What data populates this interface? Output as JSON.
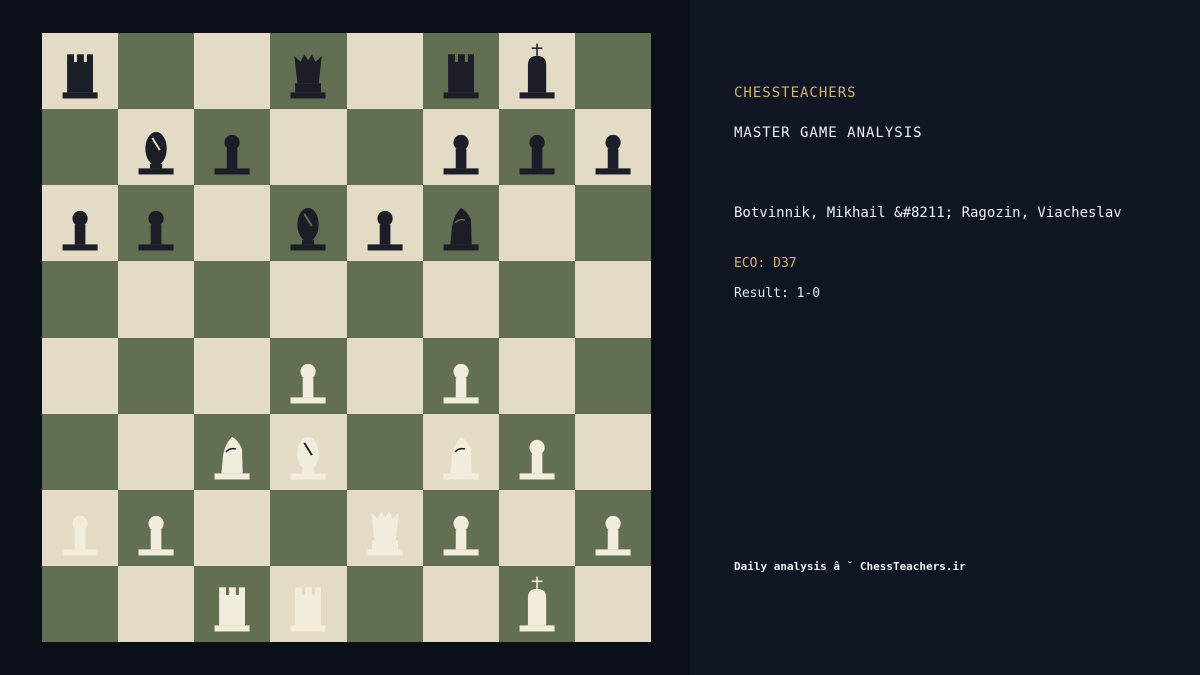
{
  "colors": {
    "light_square": "#e3dbc5",
    "dark_square": "#636f52",
    "black_piece": "#1b1e27",
    "white_piece": "#f1ecdc",
    "accent": "#d4b26a",
    "text": "#eef0f4",
    "page_bg": "#0b0f18",
    "panel_bg": "#101624"
  },
  "board": {
    "ranks": [
      [
        "r",
        "",
        "",
        "q",
        "",
        "r",
        "k",
        ""
      ],
      [
        "",
        "b",
        "p",
        "",
        "",
        "p",
        "p",
        "p"
      ],
      [
        "p",
        "p",
        "",
        "b",
        "p",
        "n",
        "",
        ""
      ],
      [
        "",
        "",
        "",
        "",
        "",
        "",
        "",
        ""
      ],
      [
        "",
        "",
        "",
        "P",
        "",
        "P",
        "",
        ""
      ],
      [
        "",
        "",
        "N",
        "B",
        "",
        "N",
        "P",
        ""
      ],
      [
        "P",
        "P",
        "",
        "",
        "Q",
        "P",
        "",
        "P"
      ],
      [
        "",
        "",
        "R",
        "R",
        "",
        "",
        "K",
        ""
      ]
    ],
    "icons": {
      "p": "black-pawn-icon",
      "n": "black-knight-icon",
      "b": "black-bishop-icon",
      "r": "black-rook-icon",
      "q": "black-queen-icon",
      "k": "black-king-icon",
      "P": "white-pawn-icon",
      "N": "white-knight-icon",
      "B": "white-bishop-icon",
      "R": "white-rook-icon",
      "Q": "white-queen-icon",
      "K": "white-king-icon"
    }
  },
  "info": {
    "brand": "CHESSTEACHERS",
    "subtitle": "MASTER GAME ANALYSIS",
    "players": "Botvinnik, Mikhail &#8211; Ragozin, Viacheslav",
    "eco": "ECO: D37",
    "result": "Result: 1-0",
    "footer": "Daily analysis â ˘ ChessTeachers.ir"
  }
}
